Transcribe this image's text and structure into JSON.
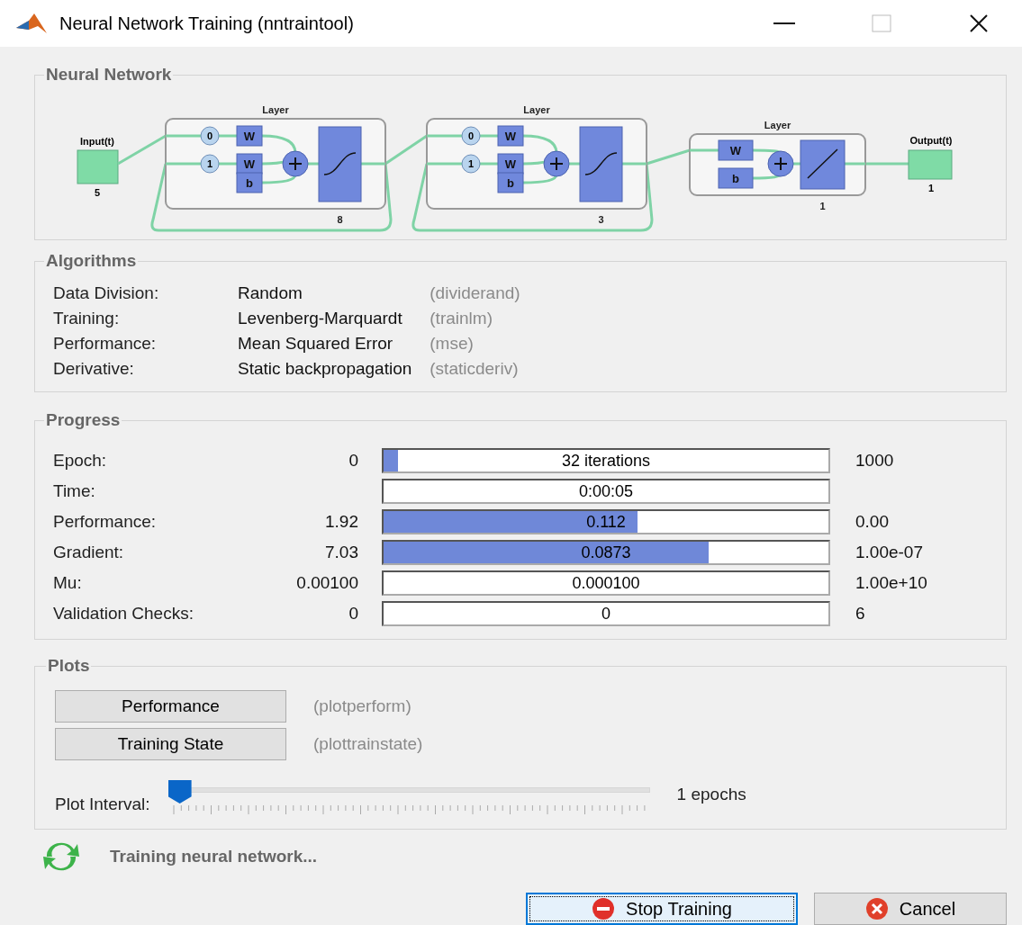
{
  "window": {
    "title": "Neural Network Training (nntraintool)"
  },
  "network": {
    "title": "Neural Network",
    "input": {
      "label": "Input(t)",
      "size": "5"
    },
    "layers": [
      {
        "label": "Layer",
        "size": "8",
        "kind": "tapped",
        "delays": [
          "0",
          "1"
        ],
        "weights": [
          "W",
          "W"
        ],
        "bias": "b",
        "transfer": {
          "kind": "sigmoid"
        }
      },
      {
        "label": "Layer",
        "size": "3",
        "kind": "tapped",
        "delays": [
          "0",
          "1"
        ],
        "weights": [
          "W",
          "W"
        ],
        "bias": "b",
        "transfer": {
          "kind": "sigmoid"
        }
      },
      {
        "label": "Layer",
        "size": "1",
        "kind": "plain",
        "weights": [
          "W"
        ],
        "bias": "b",
        "transfer": {
          "kind": "linear"
        }
      }
    ],
    "output": {
      "label": "Output(t)",
      "size": "1"
    }
  },
  "algorithms": {
    "title": "Algorithms",
    "rows": [
      {
        "label": "Data Division:",
        "value": "Random",
        "function": "(dividerand)"
      },
      {
        "label": "Training:",
        "value": "Levenberg-Marquardt",
        "function": "(trainlm)"
      },
      {
        "label": "Performance:",
        "value": "Mean Squared Error",
        "function": "(mse)"
      },
      {
        "label": "Derivative:",
        "value": "Static backpropagation",
        "function": "(staticderiv)"
      }
    ]
  },
  "progress": {
    "title": "Progress",
    "rows": [
      {
        "label": "Epoch:",
        "start": "0",
        "value": "32 iterations",
        "level": 0.032,
        "end": "1000"
      },
      {
        "label": "Time:",
        "value": "0:00:05"
      },
      {
        "label": "Performance:",
        "start": "1.92",
        "value": "0.112",
        "level": 0.57,
        "end": "0.00"
      },
      {
        "label": "Gradient:",
        "start": "7.03",
        "value": "0.0873",
        "level": 0.73,
        "end": "1.00e-07"
      },
      {
        "label": "Mu:",
        "start": "0.00100",
        "value": "0.000100",
        "end": "1.00e+10"
      },
      {
        "label": "Validation Checks:",
        "start": "0",
        "value": "0",
        "end": "6"
      }
    ]
  },
  "plots": {
    "title": "Plots",
    "buttons": [
      {
        "label": "Performance",
        "function": "(plotperform)"
      },
      {
        "label": "Training State",
        "function": "(plottrainstate)"
      }
    ],
    "interval": {
      "label": "Plot Interval:",
      "level": 0,
      "reading": "1 epochs"
    }
  },
  "status": "Training neural network...",
  "buttons": [
    {
      "label": "Stop Training",
      "kind": "stop",
      "focused": true
    },
    {
      "label": "Cancel",
      "kind": "cancel",
      "focused": false
    }
  ]
}
